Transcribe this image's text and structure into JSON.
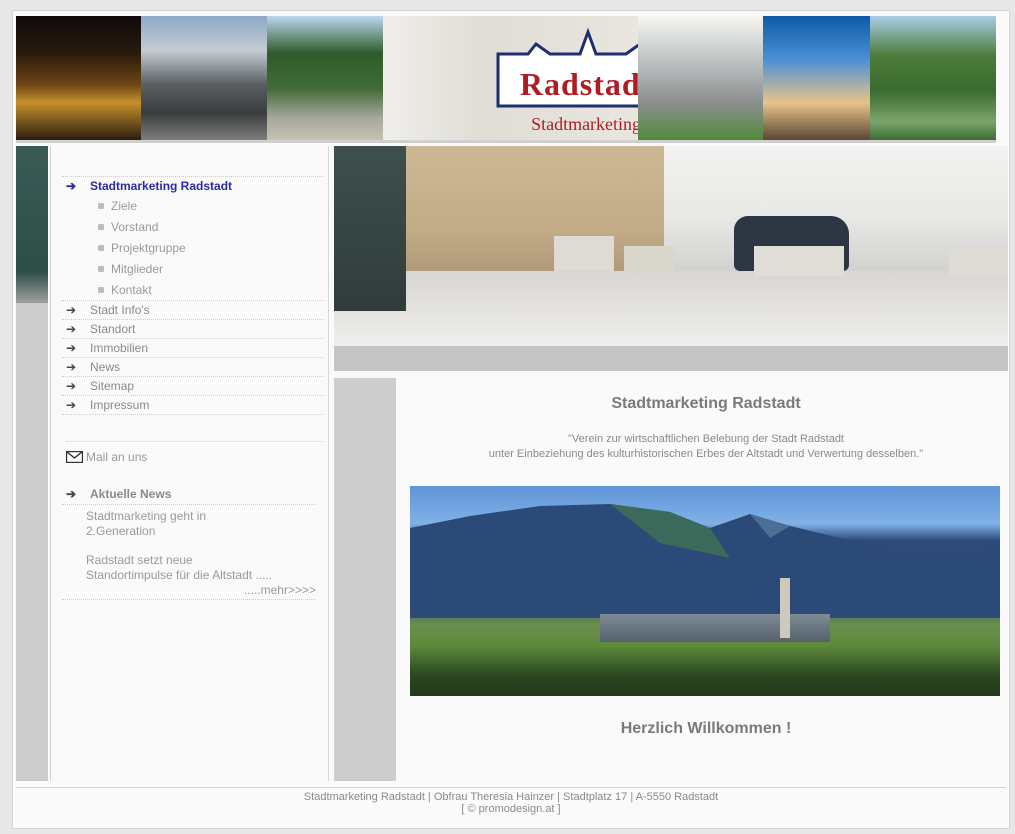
{
  "header": {
    "logo_title": "Radstadt",
    "logo_subtitle": "Stadtmarketing"
  },
  "nav": {
    "active": {
      "label": "Stadtmarketing Radstadt"
    },
    "subitems": [
      "Ziele",
      "Vorstand",
      "Projektgruppe",
      "Mitglieder",
      "Kontakt"
    ],
    "items": [
      "Stadt Info's",
      "Standort",
      "Immobilien",
      "News",
      "Sitemap",
      "Impressum"
    ]
  },
  "mail": {
    "label": "Mail an uns"
  },
  "news": {
    "heading": "Aktuelle News",
    "item1_line1": "Stadtmarketing geht in",
    "item1_line2": "2.Generation",
    "item2_line1": "Radstadt setzt neue",
    "item2_line2": "Standortimpulse für die Altstadt .....",
    "more": ".....mehr>>>>"
  },
  "main": {
    "title": "Stadtmarketing Radstadt",
    "quote_line1": "\"Verein zur wirtschaftlichen Belebung der Stadt Radstadt",
    "quote_line2": "unter Einbeziehung des kulturhistorischen Erbes der Altstadt und Verwertung desselben.\"",
    "welcome": "Herzlich Willkommen !"
  },
  "footer": {
    "line1": "Stadtmarketing Radstadt | Obfrau Theresia Hainzer | Stadtplatz 17 | A-5550 Radstadt",
    "line2": "[ © promodesign.at ]"
  },
  "colors": {
    "logo_red": "#b01c24",
    "active_nav": "#2a2aa8",
    "text_gray": "#8a8a8a"
  }
}
